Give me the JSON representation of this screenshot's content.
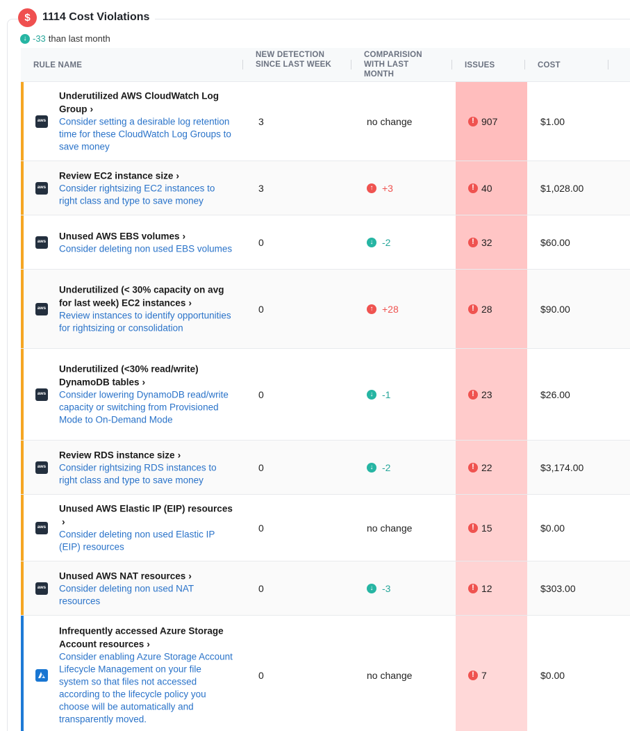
{
  "header": {
    "badge_symbol": "$",
    "title": "1114 Cost Violations",
    "delta_value": "-33",
    "delta_text": "than last month"
  },
  "table": {
    "columns": [
      "RULE NAME",
      "NEW DETECTION SINCE LAST WEEK",
      "COMPARISION WITH LAST MONTH",
      "ISSUES",
      "COST"
    ],
    "rows": [
      {
        "provider": "aws",
        "title": "Underutilized AWS CloudWatch Log Group",
        "description": "Consider setting a desirable log retention time for these CloudWatch Log Groups to save money",
        "new_detection": "3",
        "comparison": "no change",
        "comparison_dir": "none",
        "issues": "907",
        "cost": "$1.00"
      },
      {
        "provider": "aws",
        "title": "Review EC2 instance size",
        "description": "Consider rightsizing EC2 instances to right class and type to save money",
        "new_detection": "3",
        "comparison": "+3",
        "comparison_dir": "up",
        "issues": "40",
        "cost": "$1,028.00"
      },
      {
        "provider": "aws",
        "title": "Unused AWS EBS volumes",
        "description": "Consider deleting non used EBS volumes",
        "new_detection": "0",
        "comparison": "-2",
        "comparison_dir": "down",
        "issues": "32",
        "cost": "$60.00"
      },
      {
        "provider": "aws",
        "title": "Underutilized (< 30% capacity on avg for last week) EC2 instances",
        "description": "Review instances to identify opportunities for rightsizing or consolidation",
        "new_detection": "0",
        "comparison": "+28",
        "comparison_dir": "up",
        "issues": "28",
        "cost": "$90.00"
      },
      {
        "provider": "aws",
        "title": "Underutilized (<30% read/write) DynamoDB tables",
        "description": "Consider lowering DynamoDB read/write capacity or switching from Provisioned Mode to On-Demand Mode",
        "new_detection": "0",
        "comparison": "-1",
        "comparison_dir": "down",
        "issues": "23",
        "cost": "$26.00"
      },
      {
        "provider": "aws",
        "title": "Review RDS instance size",
        "description": "Consider rightsizing RDS instances to right class and type to save money",
        "new_detection": "0",
        "comparison": "-2",
        "comparison_dir": "down",
        "issues": "22",
        "cost": "$3,174.00"
      },
      {
        "provider": "aws",
        "title": "Unused AWS Elastic IP (EIP) resources",
        "description": "Consider deleting non used Elastic IP (EIP) resources",
        "new_detection": "0",
        "comparison": "no change",
        "comparison_dir": "none",
        "issues": "15",
        "cost": "$0.00"
      },
      {
        "provider": "aws",
        "title": "Unused AWS NAT resources",
        "description": "Consider deleting non used NAT resources",
        "new_detection": "0",
        "comparison": "-3",
        "comparison_dir": "down",
        "issues": "12",
        "cost": "$303.00"
      },
      {
        "provider": "azure",
        "title": "Infrequently accessed Azure Storage Account resources",
        "description": "Consider enabling Azure Storage Account Lifecycle Management on your file system so that files not accessed according to the lifecycle policy you choose will be automatically and transparently moved.",
        "new_detection": "0",
        "comparison": "no change",
        "comparison_dir": "none",
        "issues": "7",
        "cost": "$0.00"
      }
    ]
  },
  "icons": {
    "aws_label": "aws"
  },
  "colors": {
    "aws_accent": "#f5a623",
    "azure_accent": "#1e7ad6",
    "issues_bg": [
      "#ffbdbd",
      "#ffc2c2",
      "#ffc5c5",
      "#ffc8c8",
      "#ffcbcb",
      "#ffcdcd",
      "#ffd0d0",
      "#ffd3d3",
      "#ffd8d8"
    ]
  }
}
